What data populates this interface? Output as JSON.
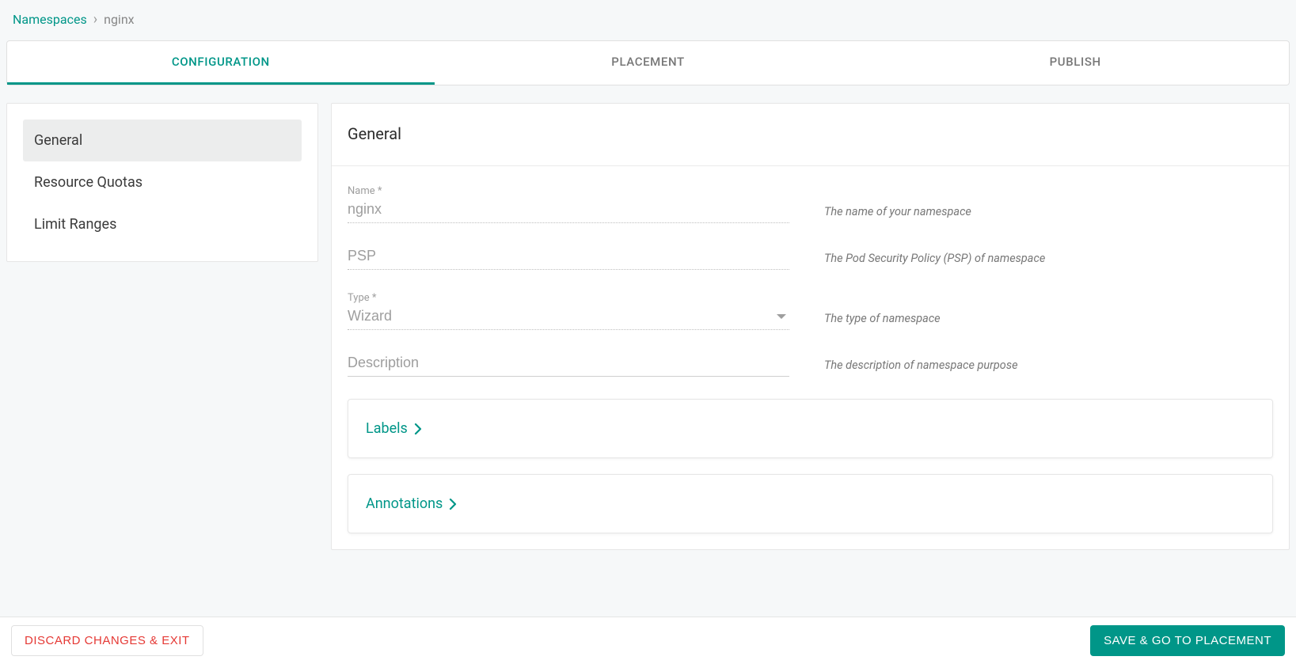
{
  "breadcrumb": {
    "link": "Namespaces",
    "separator": "›",
    "current": "nginx"
  },
  "tabs": [
    {
      "label": "CONFIGURATION",
      "active": true
    },
    {
      "label": "PLACEMENT",
      "active": false
    },
    {
      "label": "PUBLISH",
      "active": false
    }
  ],
  "sidebar": {
    "items": [
      {
        "label": "General",
        "active": true
      },
      {
        "label": "Resource Quotas",
        "active": false
      },
      {
        "label": "Limit Ranges",
        "active": false
      }
    ]
  },
  "panel": {
    "title": "General",
    "fields": {
      "name": {
        "label": "Name *",
        "value": "nginx",
        "help": "The name of your namespace"
      },
      "psp": {
        "label": "PSP",
        "value": "",
        "help": "The Pod Security Policy (PSP) of namespace",
        "placeholder": "PSP"
      },
      "type": {
        "label": "Type *",
        "value": "Wizard",
        "help": "The type of namespace"
      },
      "description": {
        "label": "",
        "value": "",
        "help": "The description of namespace purpose",
        "placeholder": "Description"
      }
    },
    "expanders": {
      "labels": "Labels",
      "annotations": "Annotations"
    }
  },
  "footer": {
    "discard": "DISCARD CHANGES & EXIT",
    "save": "SAVE & GO TO PLACEMENT"
  }
}
